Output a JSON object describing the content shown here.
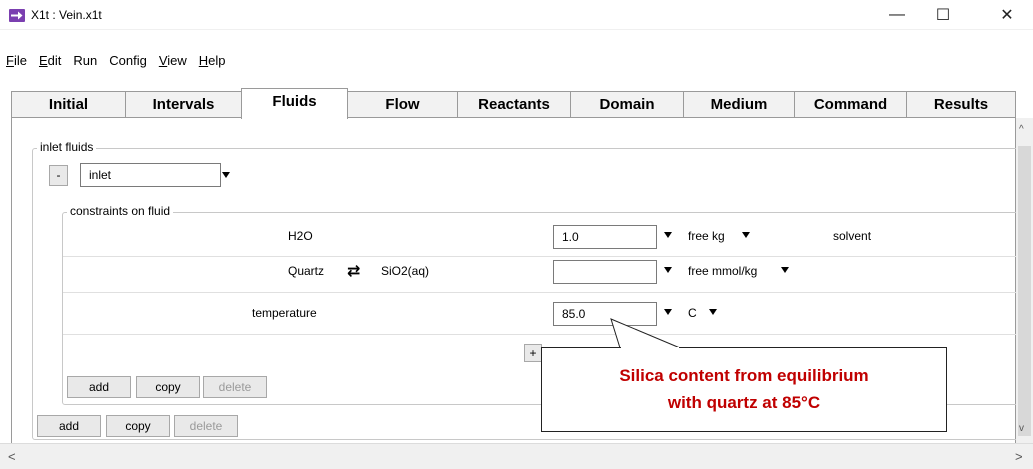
{
  "window": {
    "title": "X1t : Vein.x1t",
    "minimize": "—",
    "maximize": "☐",
    "close": "✕"
  },
  "menu": [
    {
      "label": "File",
      "u": "F",
      "rest": "ile"
    },
    {
      "label": "Edit",
      "u": "E",
      "rest": "dit"
    },
    {
      "label": "Run",
      "u": "",
      "rest": "Run"
    },
    {
      "label": "Config",
      "u": "",
      "rest": "Config"
    },
    {
      "label": "View",
      "u": "V",
      "rest": "iew"
    },
    {
      "label": "Help",
      "u": "H",
      "rest": "elp"
    }
  ],
  "tabs": [
    "Initial",
    "Intervals",
    "Fluids",
    "Flow",
    "Reactants",
    "Domain",
    "Medium",
    "Command",
    "Results"
  ],
  "active_tab": "Fluids",
  "inlet_group": {
    "legend": "inlet fluids",
    "collapse_label": "-",
    "fluid_name": "inlet"
  },
  "constraints_group": {
    "legend": "constraints on fluid",
    "rows": [
      {
        "species": "H2O",
        "swap_species": "",
        "value": "1.0",
        "unit": "free kg",
        "note": "solvent"
      },
      {
        "species": "Quartz",
        "swap_species": "SiO2(aq)",
        "value": "",
        "unit": "free mmol/kg",
        "note": ""
      },
      {
        "species": "temperature",
        "swap_species": "",
        "value": "85.0",
        "unit": "C",
        "note": ""
      }
    ],
    "plus_label": "+",
    "swap_icon": "⇄"
  },
  "inner_buttons": {
    "add": "add",
    "copy": "copy",
    "delete": "delete"
  },
  "outer_buttons": {
    "add": "add",
    "copy": "copy",
    "delete": "delete"
  },
  "callout": {
    "line1": "Silica content from equilibrium",
    "line2": "with quartz at 85°C",
    "color": "#c00000"
  },
  "scroll": {
    "up": "^",
    "down": "v",
    "left": "<",
    "right": ">"
  }
}
